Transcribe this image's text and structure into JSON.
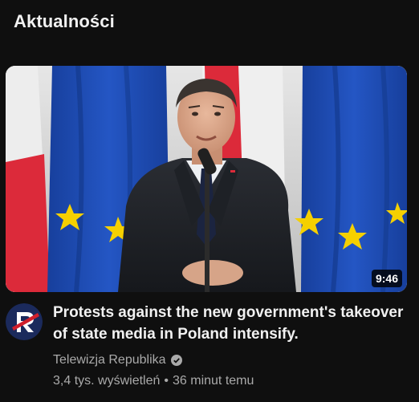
{
  "shelf": {
    "title": "Aktualności"
  },
  "video": {
    "duration": "9:46",
    "title": "Protests against the new government's takeover of state media in Poland intensify.",
    "channel": "Telewizja Republika",
    "channel_verified": true,
    "channel_avatar_icon": "republika-logo-icon",
    "views": "3,4 tys. wyświetleń",
    "separator": "•",
    "age": "36 minut temu"
  },
  "colors": {
    "background": "#0f0f0f",
    "primary_text": "#f1f1f1",
    "secondary_text": "#aaaaaa",
    "eu_blue": "#1f4fb5",
    "eu_star": "#f5d000",
    "pl_red": "#dc2a3a",
    "logo_navy": "#1b2a5c",
    "logo_red": "#d11f2b"
  }
}
